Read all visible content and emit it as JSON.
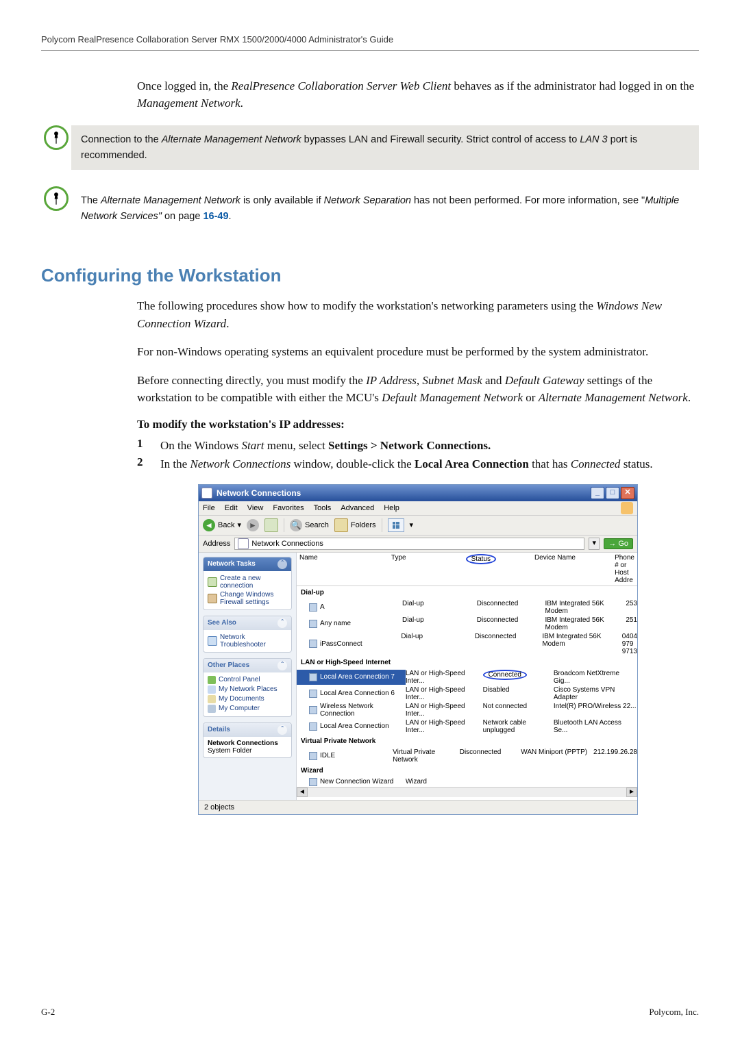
{
  "header": "Polycom RealPresence Collaboration Server RMX 1500/2000/4000 Administrator's Guide",
  "intro": {
    "prefix": "Once logged in, the ",
    "em": "RealPresence Collaboration Server Web Client",
    "mid": " behaves as if the administrator had logged in on the ",
    "em2": "Management Network",
    "suffix": "."
  },
  "note1": {
    "a": "Connection to the ",
    "b_em": "Alternate Management Network",
    "c": " bypasses LAN and Firewall security. Strict control of access to ",
    "d_em": "LAN 3",
    "e": " port is recommended."
  },
  "note2": {
    "a": "The ",
    "b_em": "Alternate Management Network",
    "c": " is only available if ",
    "d_em": "Network Separation",
    "e": " has not been performed. For more information, see \"",
    "f_em": "Multiple Network Services\"",
    "g": " on page ",
    "link": "16-49",
    "h": "."
  },
  "section_title": "Configuring the Workstation",
  "p1": {
    "a": "The following procedures show how to modify the workstation's networking parameters using the ",
    "em": "Windows New Connection Wizard",
    "b": "."
  },
  "p2": "For non-Windows operating systems an equivalent procedure must be performed by the system administrator.",
  "p3": {
    "a": "Before connecting directly, you must modify the ",
    "em1": "IP Address",
    "sep1": ", ",
    "em2": "Subnet Mask",
    "sep2": " and ",
    "em3": "Default Gateway",
    "b": " settings of the workstation to be compatible with either the MCU's ",
    "em4": "Default Management Network",
    "sep3": " or ",
    "em5": "Alternate Management Network",
    "c": "."
  },
  "subhead": "To modify the workstation's IP addresses:",
  "step1": {
    "num": "1",
    "a": "On the Windows ",
    "em": "Start",
    "b": " menu, select ",
    "bold": "Settings > Network Connections.",
    "c": ""
  },
  "step2": {
    "num": "2",
    "a": "In the ",
    "em1": "Network Connections",
    "b": " window, double-click the ",
    "bold": "Local Area Connection",
    "c": " that has ",
    "em2": "Connected",
    "d": " status."
  },
  "nc": {
    "title": "Network Connections",
    "menus": [
      "File",
      "Edit",
      "View",
      "Favorites",
      "Tools",
      "Advanced",
      "Help"
    ],
    "toolbar": {
      "back": "Back",
      "search": "Search",
      "folders": "Folders"
    },
    "address_label": "Address",
    "address_value": "Network Connections",
    "go": "Go",
    "cols": {
      "name": "Name",
      "type": "Type",
      "status": "Status",
      "device": "Device Name",
      "phone": "Phone # or Host Addre"
    },
    "side": {
      "tasks_hd": "Network Tasks",
      "tasks": [
        "Create a new connection",
        "Change Windows Firewall settings"
      ],
      "see_hd": "See Also",
      "see": [
        "Network Troubleshooter"
      ],
      "other_hd": "Other Places",
      "other": [
        "Control Panel",
        "My Network Places",
        "My Documents",
        "My Computer"
      ],
      "details_hd": "Details",
      "details_t": "Network Connections",
      "details_s": "System Folder"
    },
    "groups": {
      "dialup": "Dial-up",
      "lan": "LAN or High-Speed Internet",
      "vpn": "Virtual Private Network",
      "wiz": "Wizard"
    },
    "dialup_rows": [
      {
        "name": "A",
        "type": "Dial-up",
        "status": "Disconnected",
        "dev": "IBM Integrated 56K Modem",
        "ph": "253"
      },
      {
        "name": "Any name",
        "type": "Dial-up",
        "status": "Disconnected",
        "dev": "IBM Integrated 56K Modem",
        "ph": "251"
      },
      {
        "name": "iPassConnect",
        "type": "Dial-up",
        "status": "Disconnected",
        "dev": "IBM Integrated 56K Modem",
        "ph": "0404 979 9713"
      }
    ],
    "lan_rows": [
      {
        "name": "Local Area Connection 7",
        "type": "LAN or High-Speed Inter...",
        "status": "Connected",
        "dev": "Broadcom NetXtreme Gig...",
        "ph": ""
      },
      {
        "name": "Local Area Connection 6",
        "type": "LAN or High-Speed Inter...",
        "status": "Disabled",
        "dev": "Cisco Systems VPN Adapter",
        "ph": ""
      },
      {
        "name": "Wireless Network Connection",
        "type": "LAN or High-Speed Inter...",
        "status": "Not connected",
        "dev": "Intel(R) PRO/Wireless 22...",
        "ph": ""
      },
      {
        "name": "Local Area Connection",
        "type": "LAN or High-Speed Inter...",
        "status": "Network cable unplugged",
        "dev": "Bluetooth LAN Access Se...",
        "ph": ""
      }
    ],
    "vpn_rows": [
      {
        "name": "IDLE",
        "type": "Virtual Private Network",
        "status": "Disconnected",
        "dev": "WAN Miniport (PPTP)",
        "ph": "212.199.26.28"
      }
    ],
    "wiz_rows": [
      {
        "name": "New Connection Wizard",
        "type": "Wizard",
        "status": "",
        "dev": "",
        "ph": ""
      }
    ],
    "status": "2 objects"
  },
  "footer": {
    "left": "G-2",
    "right": "Polycom, Inc."
  }
}
